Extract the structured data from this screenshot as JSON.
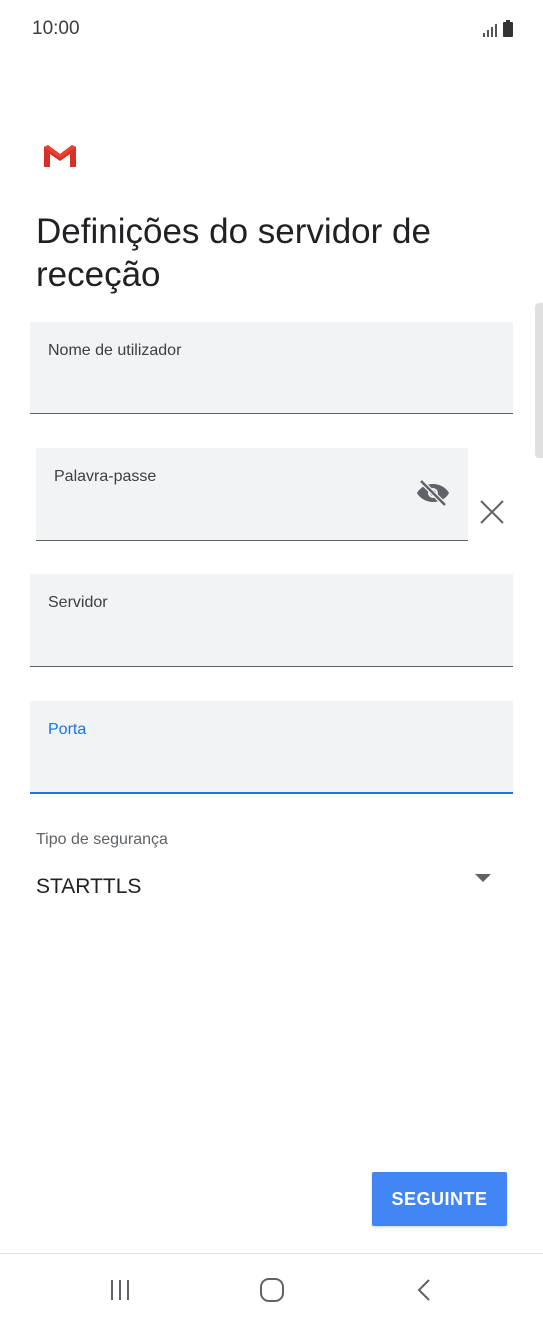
{
  "status_bar": {
    "time": "10:00",
    "signal_icon": "signal-icon",
    "battery_icon": "battery-icon"
  },
  "app": {
    "logo_icon": "gmail-logo-icon",
    "title": "Definições do servidor de receção"
  },
  "form": {
    "username": {
      "label": "Nome de utilizador",
      "value": ""
    },
    "password": {
      "label": "Palavra-passe",
      "value": "",
      "toggle_icon": "visibility-off-icon",
      "clear_icon": "close-icon"
    },
    "server": {
      "label": "Servidor",
      "value": ""
    },
    "port": {
      "label": "Porta",
      "value": ""
    },
    "security": {
      "label": "Tipo de segurança",
      "selected": "STARTTLS"
    }
  },
  "actions": {
    "next_label": "SEGUINTE"
  },
  "nav": {
    "recent_icon": "recent-apps-icon",
    "home_icon": "home-icon",
    "back_icon": "back-icon"
  },
  "colors": {
    "accent": "#1a73e8",
    "button": "#4285f4",
    "field_bg": "#f1f3f4"
  }
}
